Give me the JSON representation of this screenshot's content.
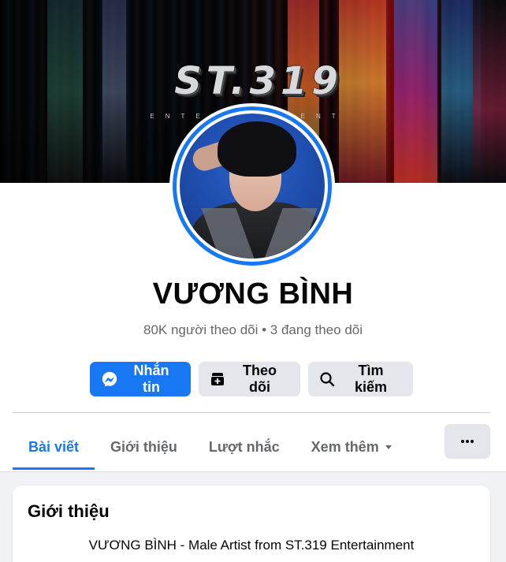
{
  "cover": {
    "logo_text": "ST.319",
    "logo_subtitle": "ENTERTAINMENT"
  },
  "profile": {
    "name": "VƯƠNG BÌNH",
    "stats": "80K người theo dõi • 3 đang theo dõi"
  },
  "actions": {
    "message_label": "Nhắn tin",
    "follow_label": "Theo dõi",
    "search_label": "Tìm kiếm"
  },
  "tabs": [
    {
      "label": "Bài viết",
      "active": true
    },
    {
      "label": "Giới thiệu",
      "active": false
    },
    {
      "label": "Lượt nhắc",
      "active": false
    },
    {
      "label": "Xem thêm",
      "active": false
    }
  ],
  "intro": {
    "title": "Giới thiệu",
    "bio": "VƯƠNG BÌNH - Male Artist from ST.319 Entertainment"
  },
  "colors": {
    "accent": "#1877f2",
    "secondary_button": "#e4e6eb",
    "muted_text": "#65676b"
  },
  "icons": {
    "message": "messenger-icon",
    "follow": "follow-plus-icon",
    "search": "search-icon",
    "dropdown": "caret-down-icon",
    "more": "more-dots-icon"
  }
}
